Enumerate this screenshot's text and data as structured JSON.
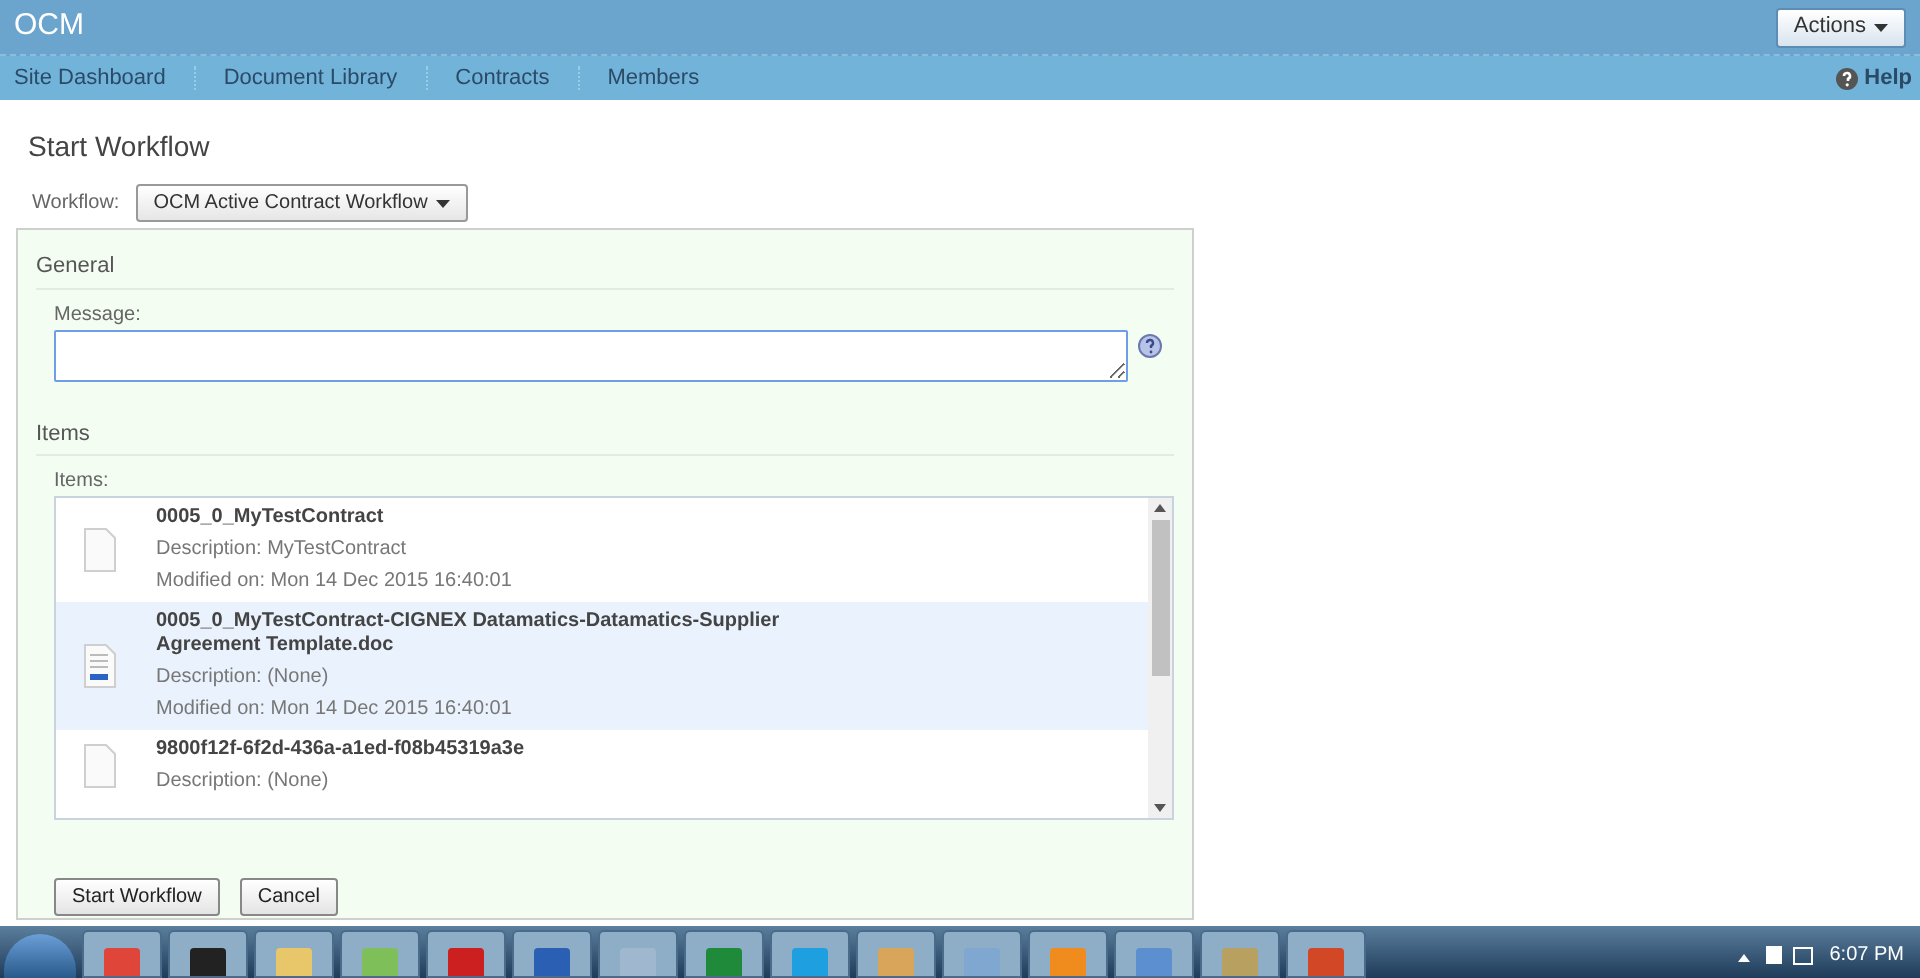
{
  "header": {
    "title": "OCM",
    "actions_button": "Actions"
  },
  "nav": {
    "items": [
      {
        "label": "Site Dashboard"
      },
      {
        "label": "Document Library"
      },
      {
        "label": "Contracts"
      },
      {
        "label": "Members"
      }
    ],
    "help": "Help"
  },
  "page_title": "Start Workflow",
  "workflow": {
    "label": "Workflow:",
    "value": "OCM Active Contract Workflow"
  },
  "general": {
    "heading": "General",
    "message_label": "Message:"
  },
  "items_section": {
    "heading": "Items",
    "label": "Items:",
    "items": [
      {
        "name": "0005_0_MyTestContract",
        "description": "Description: MyTestContract",
        "modified": "Modified on: Mon 14 Dec 2015 16:40:01",
        "kind": "file",
        "selected": false
      },
      {
        "name": "0005_0_MyTestContract-CIGNEX Datamatics-Datamatics-Supplier Agreement Template.doc",
        "description": "Description: (None)",
        "modified": "Modified on: Mon 14 Dec 2015 16:40:01",
        "kind": "doc",
        "selected": true
      },
      {
        "name": "9800f12f-6f2d-436a-a1ed-f08b45319a3e",
        "description": "Description: (None)",
        "kind": "file",
        "selected": false
      }
    ]
  },
  "buttons": [
    "Start Workflow",
    "Cancel"
  ],
  "taskbar": {
    "clock": "6:07 PM"
  }
}
